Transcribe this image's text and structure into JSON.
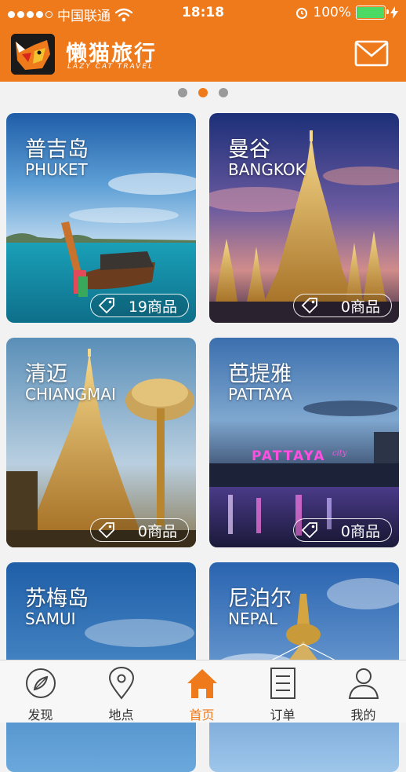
{
  "status_bar": {
    "carrier": "中国联通",
    "time": "18:18",
    "battery": "100%",
    "battery_level": 1.0
  },
  "header": {
    "brand_title": "懒猫旅行",
    "brand_subtitle": "LAZY CAT TRAVEL",
    "icons": {
      "logo": "fox-logo-icon",
      "mail": "mail-icon"
    }
  },
  "carousel": {
    "page_count": 3,
    "active_index": 1
  },
  "destinations": [
    {
      "name_zh": "普吉岛",
      "name_en": "PHUKET",
      "count_label": "19商品"
    },
    {
      "name_zh": "曼谷",
      "name_en": "BANGKOK",
      "count_label": "0商品"
    },
    {
      "name_zh": "清迈",
      "name_en": "CHIANGMAI",
      "count_label": "0商品"
    },
    {
      "name_zh": "芭提雅",
      "name_en": "PATTAYA",
      "count_label": "0商品"
    },
    {
      "name_zh": "苏梅岛",
      "name_en": "SAMUI"
    },
    {
      "name_zh": "尼泊尔",
      "name_en": "NEPAL"
    }
  ],
  "image_signs": {
    "pattaya_sign": "PATTAYA",
    "pattaya_sign_script": "city"
  },
  "tabs": [
    {
      "label": "发现",
      "icon": "compass-icon"
    },
    {
      "label": "地点",
      "icon": "location-pin-icon"
    },
    {
      "label": "首页",
      "icon": "home-icon",
      "active": true
    },
    {
      "label": "订单",
      "icon": "order-list-icon"
    },
    {
      "label": "我的",
      "icon": "user-icon"
    }
  ],
  "colors": {
    "accent": "#ee7a1c",
    "battery": "#4cd964",
    "inactive_dot": "#9a9a9a"
  }
}
